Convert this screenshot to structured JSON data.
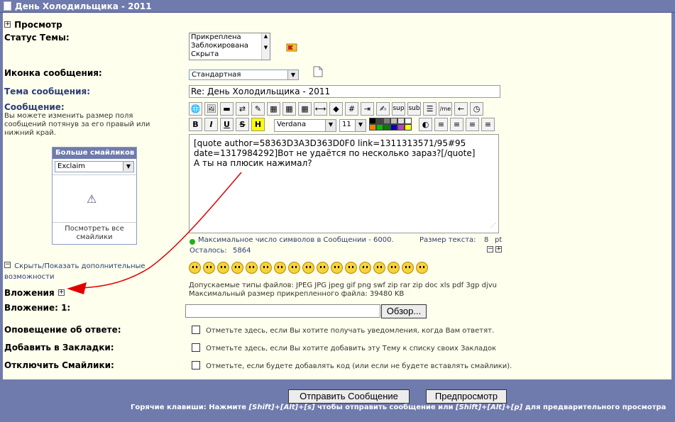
{
  "window": {
    "title": "День Холодильщика - 2011"
  },
  "preview": {
    "label": "Просмотр"
  },
  "topic_status": {
    "label": "Статус Темы:",
    "options": [
      "Прикреплена",
      "Заблокирована",
      "Скрыта"
    ]
  },
  "message_icon": {
    "label": "Иконка сообщения:",
    "value": "Стандартная"
  },
  "subject": {
    "label": "Тема сообщения:",
    "value": "Re: День Холодильщика - 2011"
  },
  "message": {
    "label": "Сообщение:",
    "hint": "Вы можете изменить размер поля сообщений потянув за его правый или нижний край.",
    "line1": "[quote author=58363D3A3D363D0F0 link=1311313571/95#95",
    "line2": "date=1317984292]Вот не удаётся по несколько зараз?[/quote]",
    "line3": "А ты на плюсик нажимал?",
    "font_value": "Verdana",
    "size_value": "11",
    "sup_label": "sup",
    "sub_label": "sub",
    "me_label": "/me",
    "hash_label": "#",
    "bold_label": "B",
    "italic_label": "I",
    "underline_label": "U",
    "strike_label": "S",
    "highlight_label": "H",
    "max_chars": "Максимальное число символов в Сообщении - 6000.",
    "remaining_label": "Осталось:",
    "remaining_value": "5864",
    "text_size_label": "Размер текста:",
    "text_size_value": "8",
    "text_size_unit": "pt",
    "minus_label": "−",
    "plus_label": "+"
  },
  "smilies_panel": {
    "title": "Больше смайликов",
    "selected": "Exclaim",
    "see_all": "Посмотреть все смайлики"
  },
  "toggle_extra": {
    "label": "Скрыть/Показать дополнительные возможности"
  },
  "attachments": {
    "label": "Вложения",
    "allowed_types": "Допускаемые типы файлов: JPEG JPG jpeg gif png swf zip rar zip doc xls pdf 3gp djvu",
    "max_size": "Максимальный размер прикрепленного файла: 39480 KB",
    "attachment1_label": "Вложение: 1:",
    "browse_label": "Обзор..."
  },
  "notify": {
    "label": "Оповещение об ответе:",
    "text": "Отметьте здесь, если Вы хотите получать уведомления, когда Вам ответят."
  },
  "bookmarks": {
    "label": "Добавить в Закладки:",
    "text": "Отметьте здесь, если Вы хотите добавить эту Тему к списку своих Закладок"
  },
  "disable_smilies": {
    "label": "Отключить Смайлики:",
    "text": "Отметьте, если будете добавлять код (или если не будете вставлять смайлики)."
  },
  "buttons": {
    "submit": "Отправить Сообщение",
    "preview": "Предпросмотр"
  },
  "hotkeys": {
    "prefix": "Горячие клавиши: Нажмите",
    "shift": "[Shift]",
    "plus": "+",
    "alt": "[Alt]",
    "s": "[s]",
    "middle": "чтобы отправить сообщение или",
    "p": "[p]",
    "suffix": "для предварительного просмотра"
  },
  "colors": {
    "accent": "#6f7bad",
    "background": "#ffffee",
    "arrow": "#e00000"
  }
}
